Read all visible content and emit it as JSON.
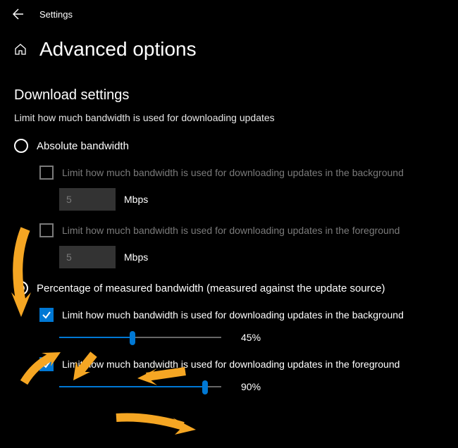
{
  "topbar": {
    "app_title": "Settings"
  },
  "header": {
    "title": "Advanced options"
  },
  "section": {
    "heading": "Download settings",
    "description": "Limit how much bandwidth is used for downloading updates"
  },
  "absolute": {
    "radio_label": "Absolute bandwidth",
    "bg_checkbox_label": "Limit how much bandwidth is used for downloading updates in the background",
    "bg_value": "5",
    "bg_unit": "Mbps",
    "fg_checkbox_label": "Limit how much bandwidth is used for downloading updates in the foreground",
    "fg_value": "5",
    "fg_unit": "Mbps"
  },
  "percentage": {
    "radio_label": "Percentage of measured bandwidth (measured against the update source)",
    "bg_checkbox_label": "Limit how much bandwidth is used for downloading updates in the background",
    "bg_slider_value": "45%",
    "bg_slider_pct": 45,
    "fg_checkbox_label": "Limit how much bandwidth is used for downloading updates in the foreground",
    "fg_slider_value": "90%",
    "fg_slider_pct": 90
  }
}
